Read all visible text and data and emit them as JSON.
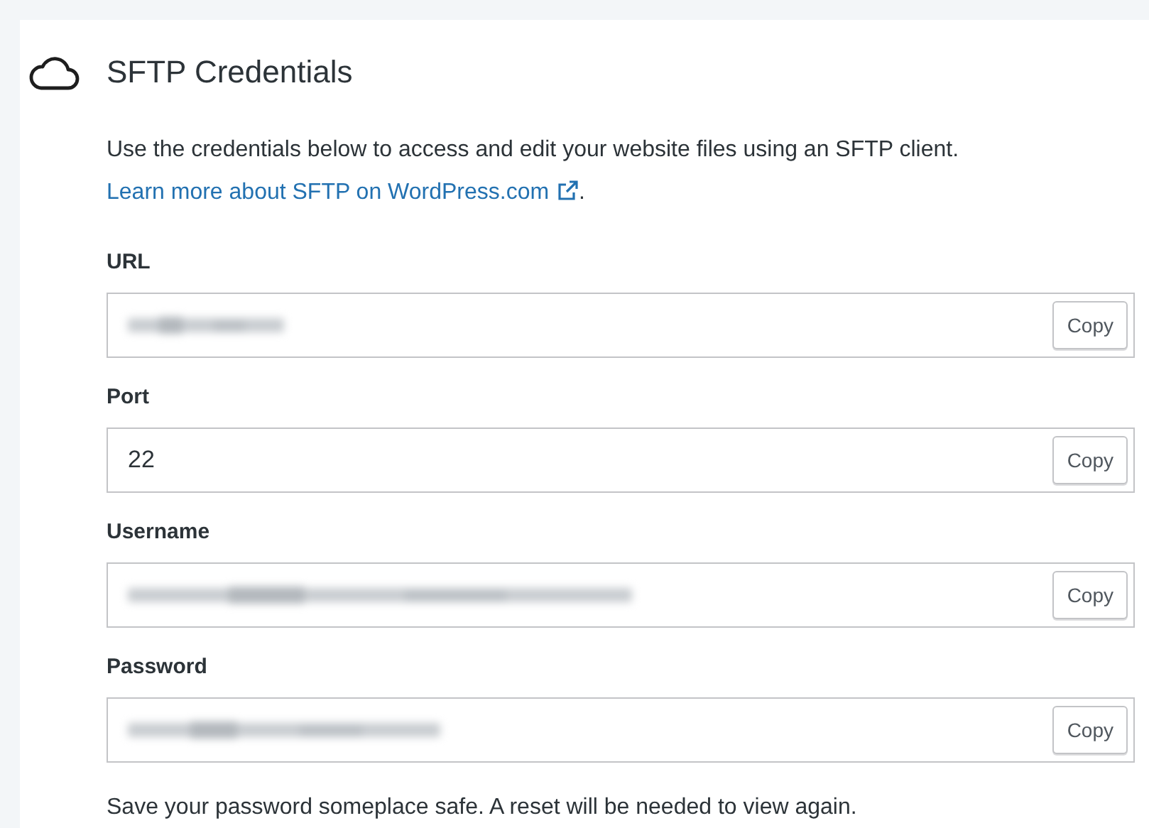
{
  "title": "SFTP Credentials",
  "description": "Use the credentials below to access and edit your website files using an SFTP client. ",
  "link": "Learn more about SFTP on WordPress.com",
  "description_end": ".",
  "fields": [
    {
      "label": "URL",
      "kind": "redacted",
      "button": "Copy"
    },
    {
      "label": "Port",
      "kind": "text",
      "value": "22",
      "button": "Copy"
    },
    {
      "label": "Username",
      "kind": "redacted",
      "button": "Copy"
    },
    {
      "label": "Password",
      "kind": "redacted",
      "button": "Copy"
    }
  ],
  "note": "Save your password someplace safe. A reset will be needed to view again."
}
